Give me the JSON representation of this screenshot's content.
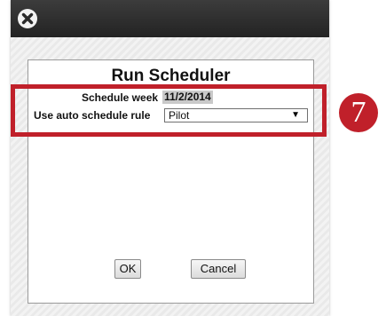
{
  "dialog": {
    "title": "Run Scheduler",
    "close_icon": "close-icon"
  },
  "form": {
    "schedule_week_label": "Schedule week",
    "schedule_week_value": "11/2/2014",
    "auto_rule_label": "Use auto schedule rule",
    "auto_rule_selected": "Pilot",
    "dropdown_arrow": "▼"
  },
  "buttons": {
    "ok_label": "OK",
    "cancel_label": "Cancel"
  },
  "annotation": {
    "step_number": "7",
    "color": "#c0202a"
  }
}
